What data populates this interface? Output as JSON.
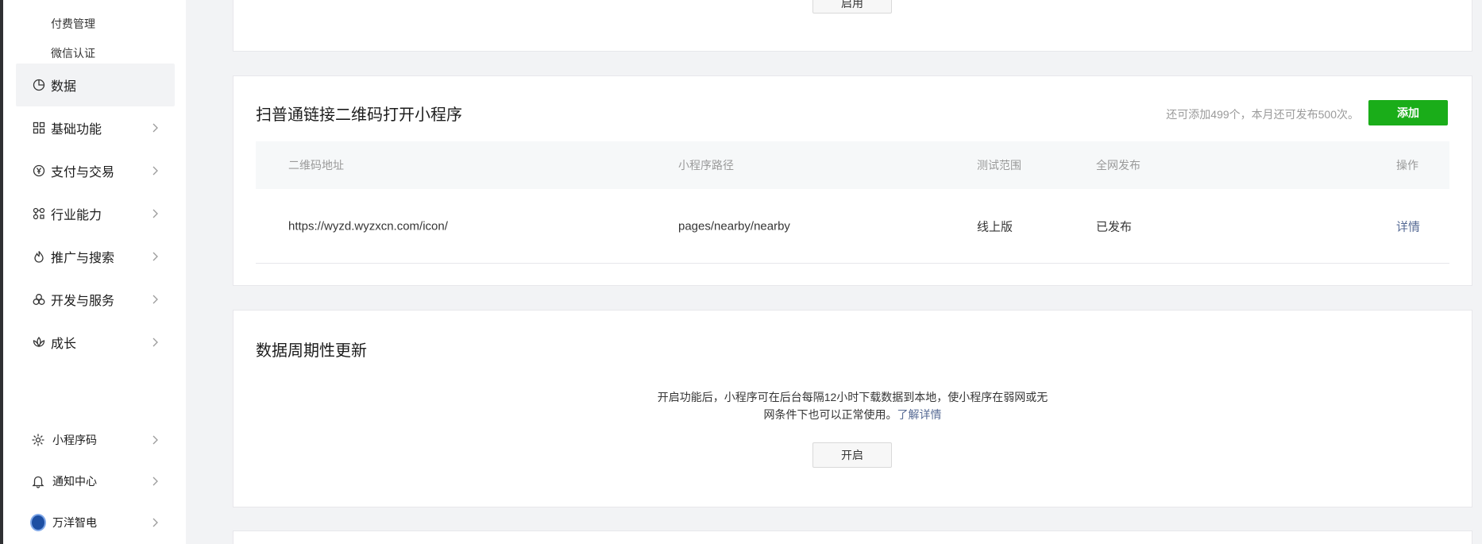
{
  "sidebar": {
    "sub_items": [
      "付费管理",
      "微信认证"
    ],
    "items": [
      {
        "label": "数据",
        "icon": "chart-pie-icon",
        "active": true
      },
      {
        "label": "基础功能",
        "icon": "grid-icon"
      },
      {
        "label": "支付与交易",
        "icon": "yen-circle-icon"
      },
      {
        "label": "行业能力",
        "icon": "nodes-icon"
      },
      {
        "label": "推广与搜索",
        "icon": "flame-icon"
      },
      {
        "label": "开发与服务",
        "icon": "circles-icon"
      },
      {
        "label": "成长",
        "icon": "lotus-icon"
      }
    ],
    "bottom": [
      {
        "label": "小程序码",
        "icon": "sun-code-icon"
      },
      {
        "label": "通知中心",
        "icon": "bell-icon"
      },
      {
        "label": "万洋智电",
        "icon": "avatar"
      }
    ]
  },
  "top_card": {
    "button_label": "启用"
  },
  "qrcode_card": {
    "title": "扫普通链接二维码打开小程序",
    "quota_text": "还可添加499个，本月还可发布500次。",
    "add_label": "添加",
    "columns": [
      "二维码地址",
      "小程序路径",
      "测试范围",
      "全网发布",
      "操作"
    ],
    "rows": [
      {
        "url": "https://wyzd.wyzxcn.com/icon/",
        "path": "pages/nearby/nearby",
        "scope": "线上版",
        "publish": "已发布",
        "action": "详情"
      }
    ]
  },
  "periodic_card": {
    "title": "数据周期性更新",
    "desc_line1": "开启功能后，小程序可在后台每隔12小时下载数据到本地，使小程序在弱网或无",
    "desc_line2": "网条件下也可以正常使用。",
    "learn_more": "了解详情",
    "open_label": "开启"
  },
  "colors": {
    "accent": "#1aad19",
    "link": "#576b95",
    "bg": "#f2f3f5"
  }
}
